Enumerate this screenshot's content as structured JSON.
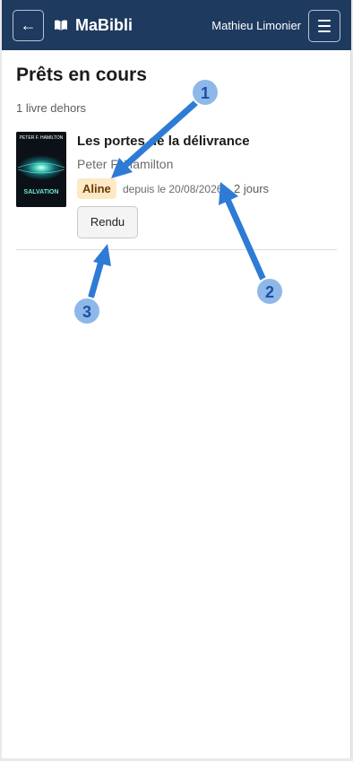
{
  "header": {
    "back_label": "←",
    "brand": "MaBibli",
    "user": "Mathieu Limonier",
    "menu_icon": "hamburger-menu-icon",
    "brand_icon": "open-book-icon",
    "colors": {
      "navbar": "#1f3a5f",
      "text": "#ffffff"
    }
  },
  "main": {
    "title": "Prêts en cours",
    "count": "1 livre dehors",
    "loans": [
      {
        "title": "Les portes de la délivrance",
        "author": "Peter F. Hamilton",
        "borrower": "Aline",
        "since": "depuis le 20/08/2026",
        "duration": "2 jours",
        "action": "Rendu",
        "cover": {
          "author": "PETER F. HAMILTON",
          "title": "SALVATION"
        }
      }
    ]
  },
  "annotations": [
    {
      "label": "1"
    },
    {
      "label": "2"
    },
    {
      "label": "3"
    }
  ],
  "colors": {
    "badge_bg": "#fde9c5",
    "badge_text": "#6a3b00",
    "annotation": "#2e7bd6",
    "annotation_circle": "#8fb8ea"
  }
}
